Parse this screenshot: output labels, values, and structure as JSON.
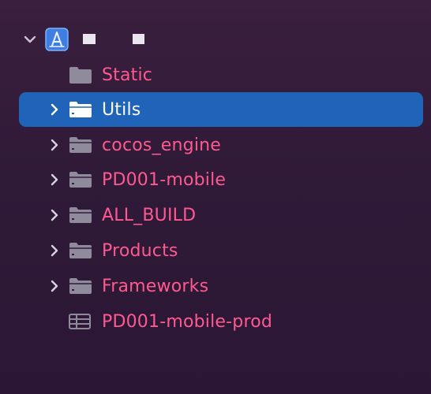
{
  "project": {
    "name": "",
    "expanded": true
  },
  "items": [
    {
      "label": "Static",
      "icon": "folder-placeholder-icon",
      "expandable": false,
      "selected": false
    },
    {
      "label": "Utils",
      "icon": "folder-icon",
      "expandable": true,
      "selected": true
    },
    {
      "label": "cocos_engine",
      "icon": "folder-icon",
      "expandable": true,
      "selected": false
    },
    {
      "label": "PD001-mobile",
      "icon": "folder-icon",
      "expandable": true,
      "selected": false
    },
    {
      "label": "ALL_BUILD",
      "icon": "folder-icon",
      "expandable": true,
      "selected": false
    },
    {
      "label": "Products",
      "icon": "folder-icon",
      "expandable": true,
      "selected": false
    },
    {
      "label": "Frameworks",
      "icon": "folder-icon",
      "expandable": true,
      "selected": false
    },
    {
      "label": "PD001-mobile-prod",
      "icon": "target-table-icon",
      "expandable": false,
      "selected": false
    }
  ],
  "colors": {
    "label": "#ff5a8f",
    "selection": "#1f64b8",
    "icon": "#8f8a9c",
    "selected_text": "#ffffff"
  }
}
